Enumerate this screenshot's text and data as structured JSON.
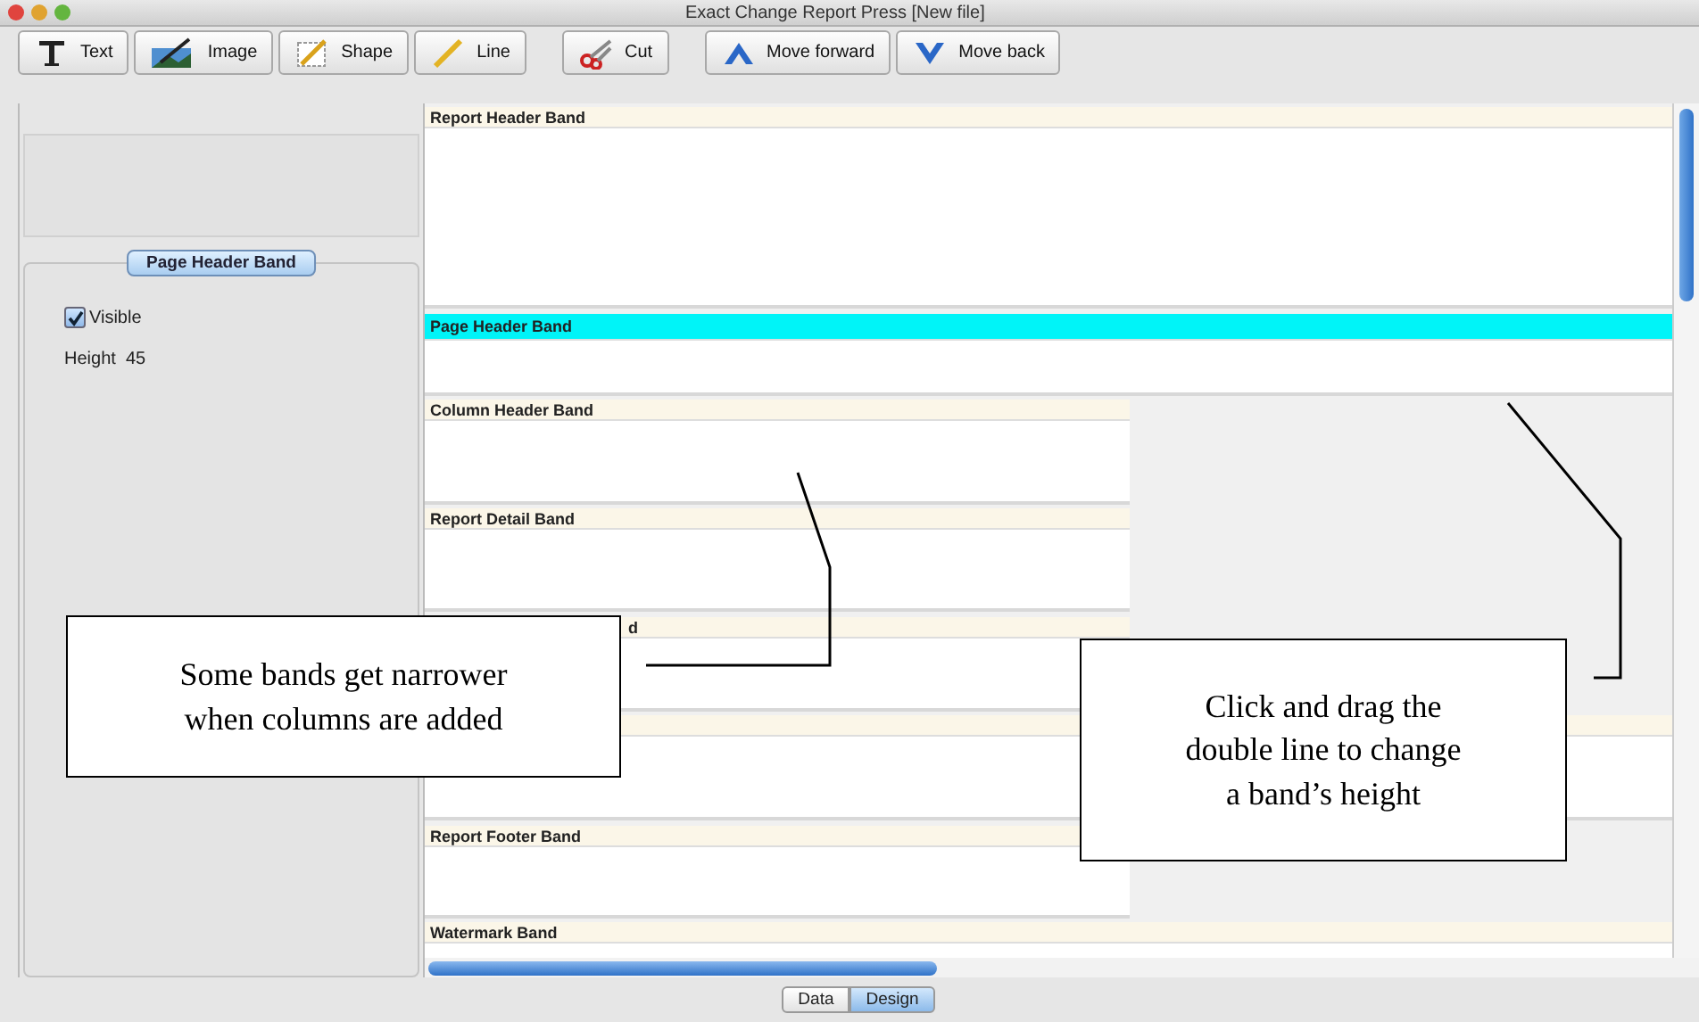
{
  "window": {
    "title": "Exact Change Report Press [New file]"
  },
  "toolbar": {
    "groups": [
      {
        "buttons": [
          {
            "label": "Text"
          },
          {
            "label": "Image"
          },
          {
            "label": "Shape"
          },
          {
            "label": "Line"
          }
        ]
      },
      {
        "buttons": [
          {
            "label": "Cut"
          }
        ]
      },
      {
        "buttons": [
          {
            "label": "Move forward"
          },
          {
            "label": "Move back"
          }
        ]
      }
    ]
  },
  "properties": {
    "group_title": "Page Header Band",
    "visible": {
      "label": "Visible",
      "checked": true
    },
    "height": {
      "label": "Height",
      "value": "45"
    }
  },
  "bands": [
    {
      "label": "Report Header Band",
      "kind": "full",
      "selected": false
    },
    {
      "label": "Page Header Band",
      "kind": "full",
      "selected": true
    },
    {
      "label": "Column Header Band",
      "kind": "column",
      "selected": false
    },
    {
      "label": "Report Detail Band",
      "kind": "column",
      "selected": false
    },
    {
      "label": "d",
      "kind": "column",
      "selected": false,
      "covered": true
    },
    {
      "kind": "full",
      "selected": false
    },
    {
      "label": "Report Footer Band",
      "kind": "column",
      "selected": false
    },
    {
      "label": "Watermark Band",
      "kind": "full",
      "selected": false
    }
  ],
  "view_tabs": [
    {
      "label": "Data",
      "selected": false
    },
    {
      "label": "Design",
      "selected": true
    }
  ],
  "annotations": [
    {
      "lines": [
        "Some bands get narrower",
        "when columns are added"
      ]
    },
    {
      "lines": [
        "Click and drag the",
        "double line to change",
        "a band’s height"
      ]
    }
  ]
}
